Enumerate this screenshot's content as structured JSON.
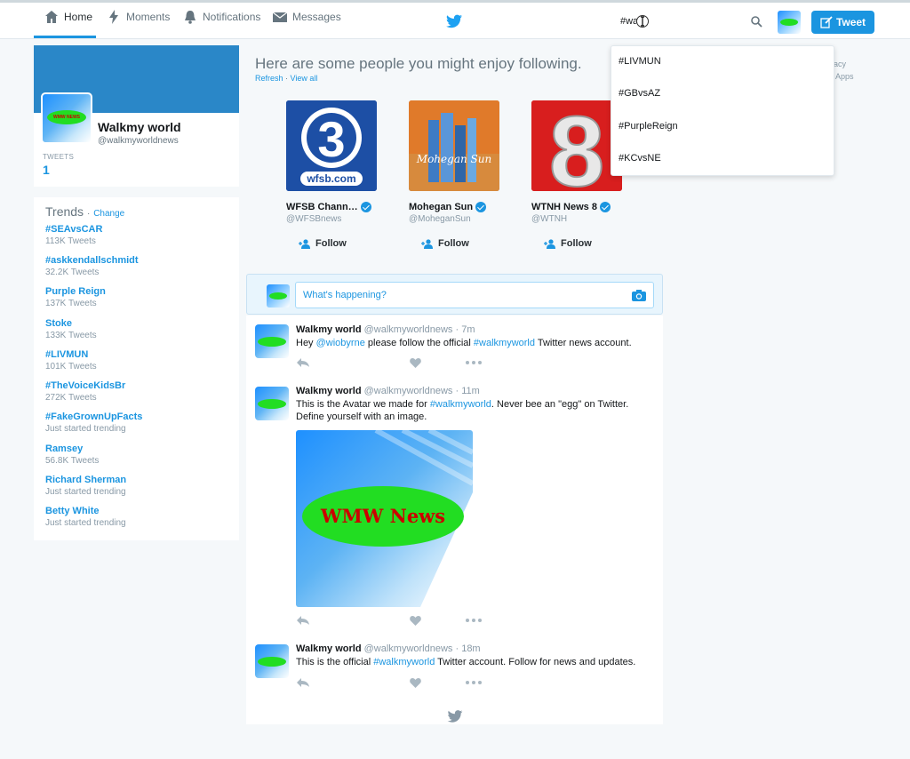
{
  "nav": {
    "home": "Home",
    "moments": "Moments",
    "notifications": "Notifications",
    "messages": "Messages",
    "search_value": "#wa",
    "tweet_button": "Tweet"
  },
  "colors": {
    "accent": "#1b95e0",
    "banner": "#2a87c8",
    "avatar_oval": "#22dd22",
    "avatar_text": "#cc0000"
  },
  "profile": {
    "name": "Walkmy world",
    "handle": "@walkmyworldnews",
    "tweets_label": "TWEETS",
    "tweets_count": "1",
    "avatar_text": "WMW NEWS"
  },
  "trends": {
    "title": "Trends",
    "sep": "·",
    "change": "Change",
    "items": [
      {
        "name": "#SEAvsCAR",
        "sub": "113K Tweets"
      },
      {
        "name": "#askkendallschmidt",
        "sub": "32.2K Tweets"
      },
      {
        "name": "Purple Reign",
        "sub": "137K Tweets"
      },
      {
        "name": "Stoke",
        "sub": "133K Tweets"
      },
      {
        "name": "#LIVMUN",
        "sub": "101K Tweets"
      },
      {
        "name": "#TheVoiceKidsBr",
        "sub": "272K Tweets"
      },
      {
        "name": "#FakeGrownUpFacts",
        "sub": "Just started trending"
      },
      {
        "name": "Ramsey",
        "sub": "56.8K Tweets"
      },
      {
        "name": "Richard Sherman",
        "sub": "Just started trending"
      },
      {
        "name": "Betty White",
        "sub": "Just started trending"
      }
    ]
  },
  "who_to_follow": {
    "title": "Here are some people you might enjoy following.",
    "refresh": "Refresh",
    "sep": "·",
    "view_all": "View all",
    "follow_label": "Follow",
    "accounts": [
      {
        "name": "WFSB Chann…",
        "handle": "@WFSBnews",
        "logo_number": "3",
        "logo_text": "wfsb.com"
      },
      {
        "name": "Mohegan Sun",
        "handle": "@MoheganSun",
        "logo_text": "Mohegan Sun"
      },
      {
        "name": "WTNH News 8",
        "handle": "@WTNH",
        "logo_number": "8"
      }
    ]
  },
  "composer": {
    "placeholder": "What's happening?"
  },
  "tweets": [
    {
      "name": "Walkmy world",
      "handle_time": "@walkmyworldnews · 7m",
      "t1": "Hey ",
      "mention": "@wiobyrne",
      "t2": " please follow the official ",
      "hashtag": "#walkmyworld",
      "t3": " Twitter news account."
    },
    {
      "name": "Walkmy world",
      "handle_time": "@walkmyworldnews · 11m",
      "t1": "This is the Avatar we made for ",
      "hashtag": "#walkmyworld",
      "t2": ". Never bee an \"egg\" on Twitter.",
      "t3": "Define yourself with an image.",
      "image_text": "WMW News"
    },
    {
      "name": "Walkmy world",
      "handle_time": "@walkmyworldnews · 18m",
      "t1": "This is the official ",
      "hashtag": "#walkmyworld",
      "t2": " Twitter account. Follow for news and updates."
    }
  ],
  "search_dropdown": {
    "items": [
      "#LIVMUN",
      "#GBvsAZ",
      "#PurpleReign",
      "#KCvsNE"
    ]
  },
  "right_column_fragments": {
    "line1": "acy",
    "line2": "Apps"
  }
}
